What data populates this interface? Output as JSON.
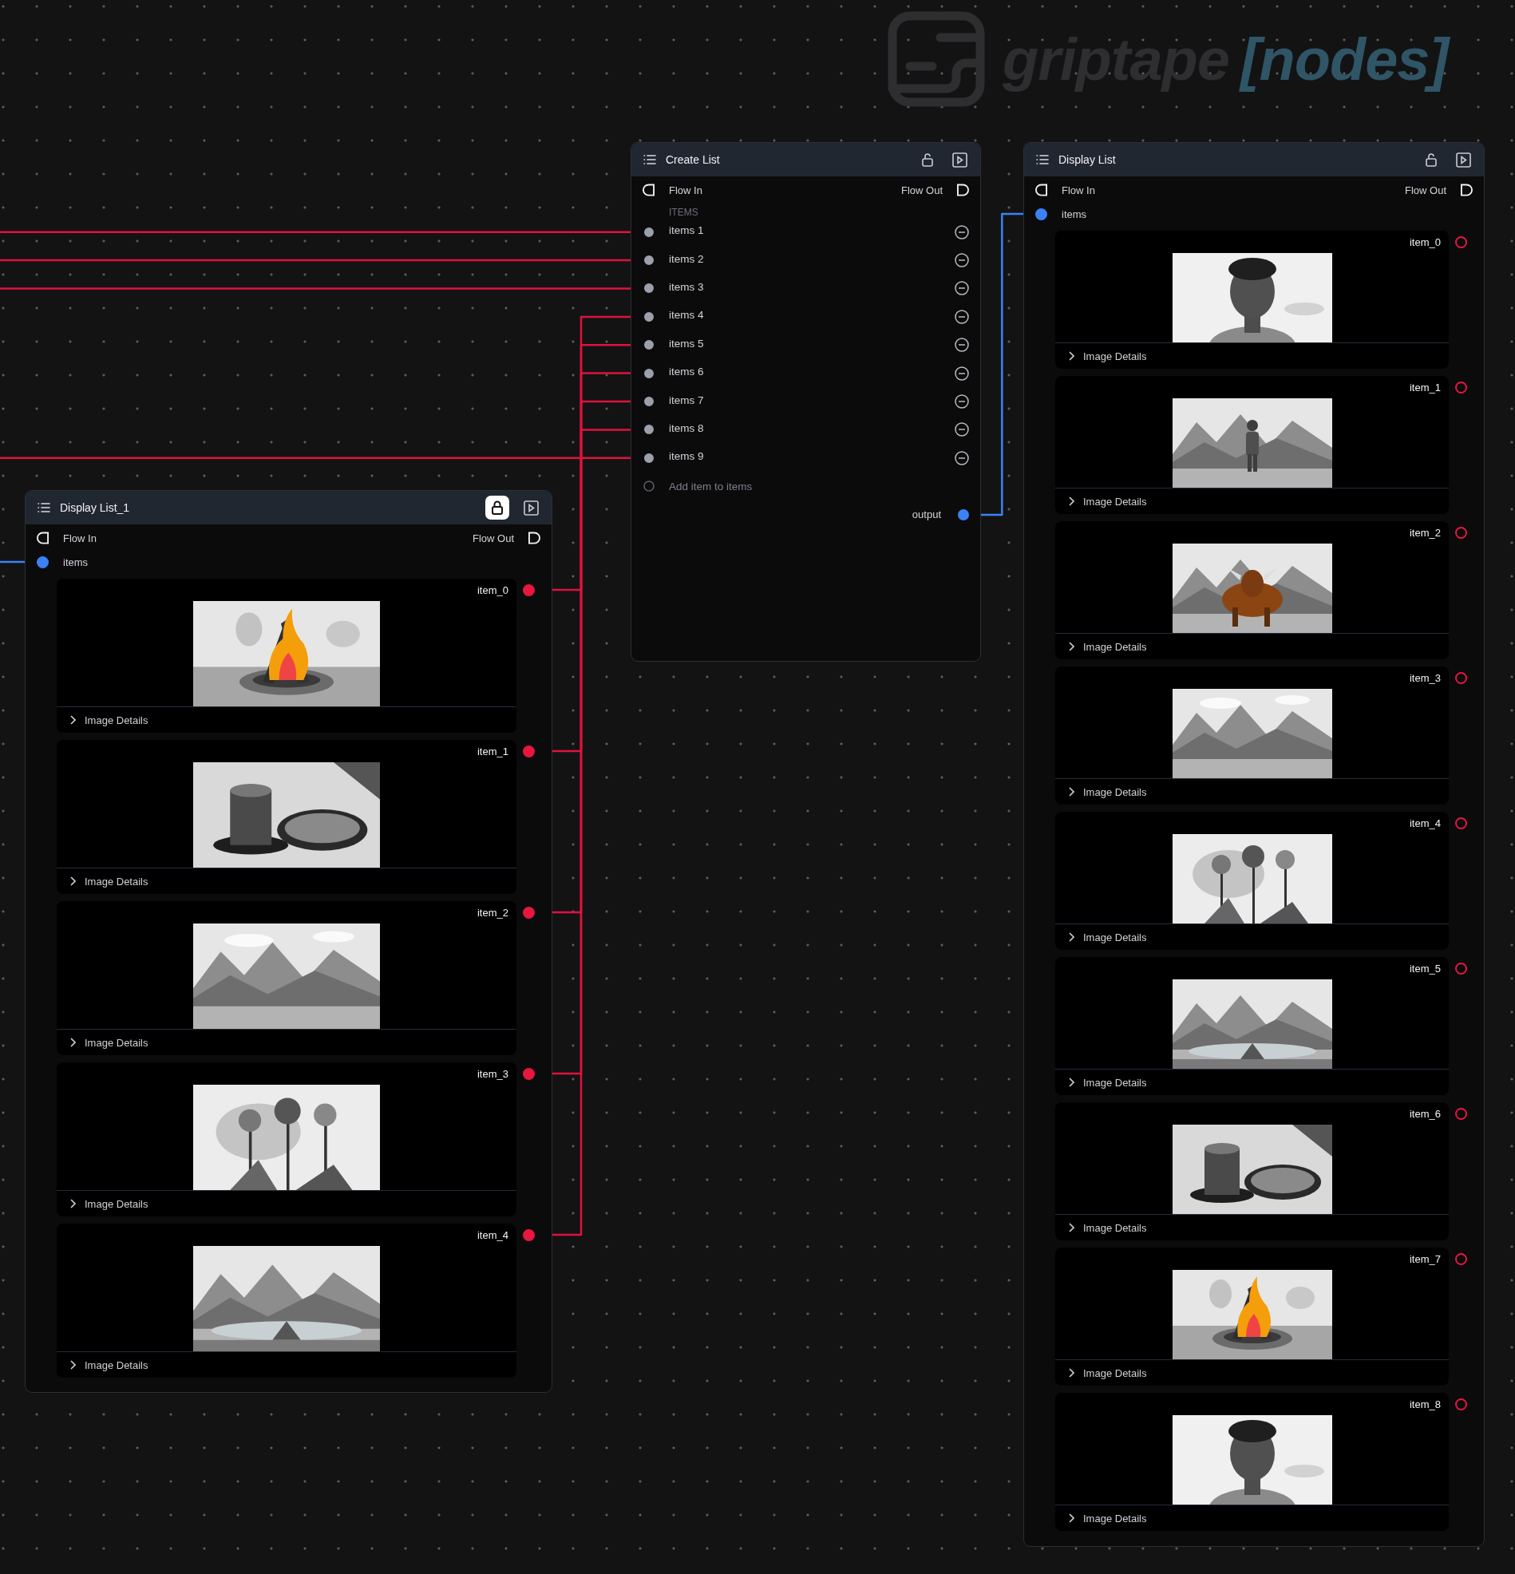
{
  "logo": {
    "name": "griptape",
    "suffix": "[nodes]"
  },
  "nodes": [
    {
      "kind": "create_list",
      "title": "Create List",
      "locked": false,
      "flow_in": "Flow In",
      "flow_out": "Flow Out",
      "group_label": "ITEMS",
      "items": [
        {
          "label": "items 1",
          "connected": true
        },
        {
          "label": "items 2",
          "connected": true
        },
        {
          "label": "items 3",
          "connected": true
        },
        {
          "label": "items 4",
          "connected": true
        },
        {
          "label": "items 5",
          "connected": true
        },
        {
          "label": "items 6",
          "connected": true
        },
        {
          "label": "items 7",
          "connected": true
        },
        {
          "label": "items 8",
          "connected": true
        },
        {
          "label": "items 9",
          "connected": true
        }
      ],
      "add_label": "Add item to items",
      "output": {
        "label": "output",
        "connected": true
      }
    },
    {
      "kind": "display_list",
      "title": "Display List_1",
      "locked": true,
      "flow_in": "Flow In",
      "flow_out": "Flow Out",
      "input": {
        "label": "items",
        "connected": true
      },
      "outputs": [
        {
          "label": "item_0",
          "connected": true,
          "details": "Image Details"
        },
        {
          "label": "item_1",
          "connected": true,
          "details": "Image Details"
        },
        {
          "label": "item_2",
          "connected": true,
          "details": "Image Details"
        },
        {
          "label": "item_3",
          "connected": true,
          "details": "Image Details"
        },
        {
          "label": "item_4",
          "connected": true,
          "details": "Image Details"
        }
      ]
    },
    {
      "kind": "display_list",
      "title": "Display List",
      "locked": false,
      "flow_in": "Flow In",
      "flow_out": "Flow Out",
      "input": {
        "label": "items",
        "connected": true
      },
      "outputs": [
        {
          "label": "item_0",
          "connected": false,
          "details": "Image Details"
        },
        {
          "label": "item_1",
          "connected": false,
          "details": "Image Details"
        },
        {
          "label": "item_2",
          "connected": false,
          "details": "Image Details"
        },
        {
          "label": "item_3",
          "connected": false,
          "details": "Image Details"
        },
        {
          "label": "item_4",
          "connected": false,
          "details": "Image Details"
        },
        {
          "label": "item_5",
          "connected": false,
          "details": "Image Details"
        },
        {
          "label": "item_6",
          "connected": false,
          "details": "Image Details"
        },
        {
          "label": "item_7",
          "connected": false,
          "details": "Image Details"
        },
        {
          "label": "item_8",
          "connected": false,
          "details": "Image Details"
        }
      ]
    }
  ]
}
